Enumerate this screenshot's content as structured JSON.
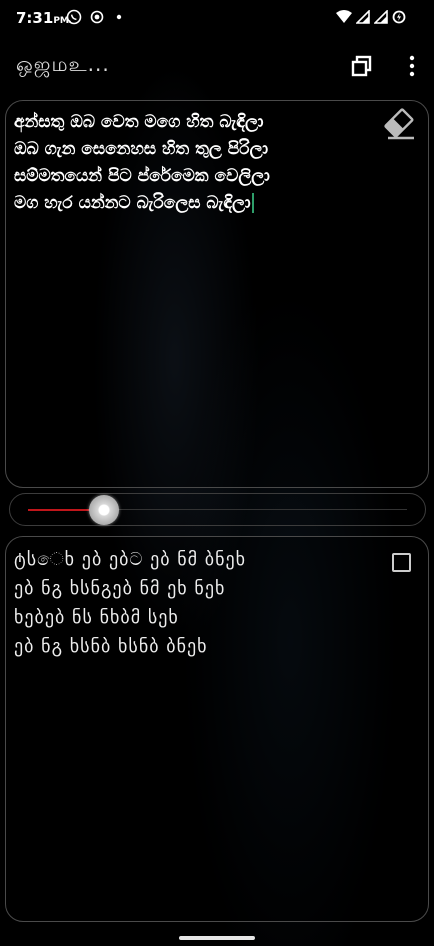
{
  "status_bar": {
    "time": "7:31",
    "ampm": "PM",
    "left_icons": [
      "whatsapp-icon",
      "radio-icon",
      "dot-icon"
    ],
    "right_icons": [
      "wifi-icon",
      "signal-icon",
      "signal-icon",
      "battery-saver-icon"
    ]
  },
  "app_bar": {
    "title": "ஒஜமஉ...",
    "actions": [
      "copy-icon",
      "more-vert-icon"
    ]
  },
  "input": {
    "lines": [
      "අන්සතු ඔබ වෙත මගෙ හිත බැඳිලා",
      "ඔබ ගැන සෙනෙහස හිත තුල පිරිලා",
      "සම්මතයෙන් පිට ප්රේමෙක වෙලිලා",
      "මග හැර යන්නට බැරිලෙස බැඳිලා"
    ],
    "clear_icon": "eraser-icon"
  },
  "slider": {
    "value": 0.2,
    "fill_color": "#c0161b"
  },
  "output": {
    "lines": [
      "ტსෙხ ებ ებට ებ ნმ ბნეხ",
      "ებ ნგ ხსნგებ ნმ ეხ ნეხ",
      "ხებებ ნს ნხბმ სეხ",
      "ებ ნგ ხსნბ ხსნბ ბნეხ"
    ],
    "checkbox_checked": false
  }
}
